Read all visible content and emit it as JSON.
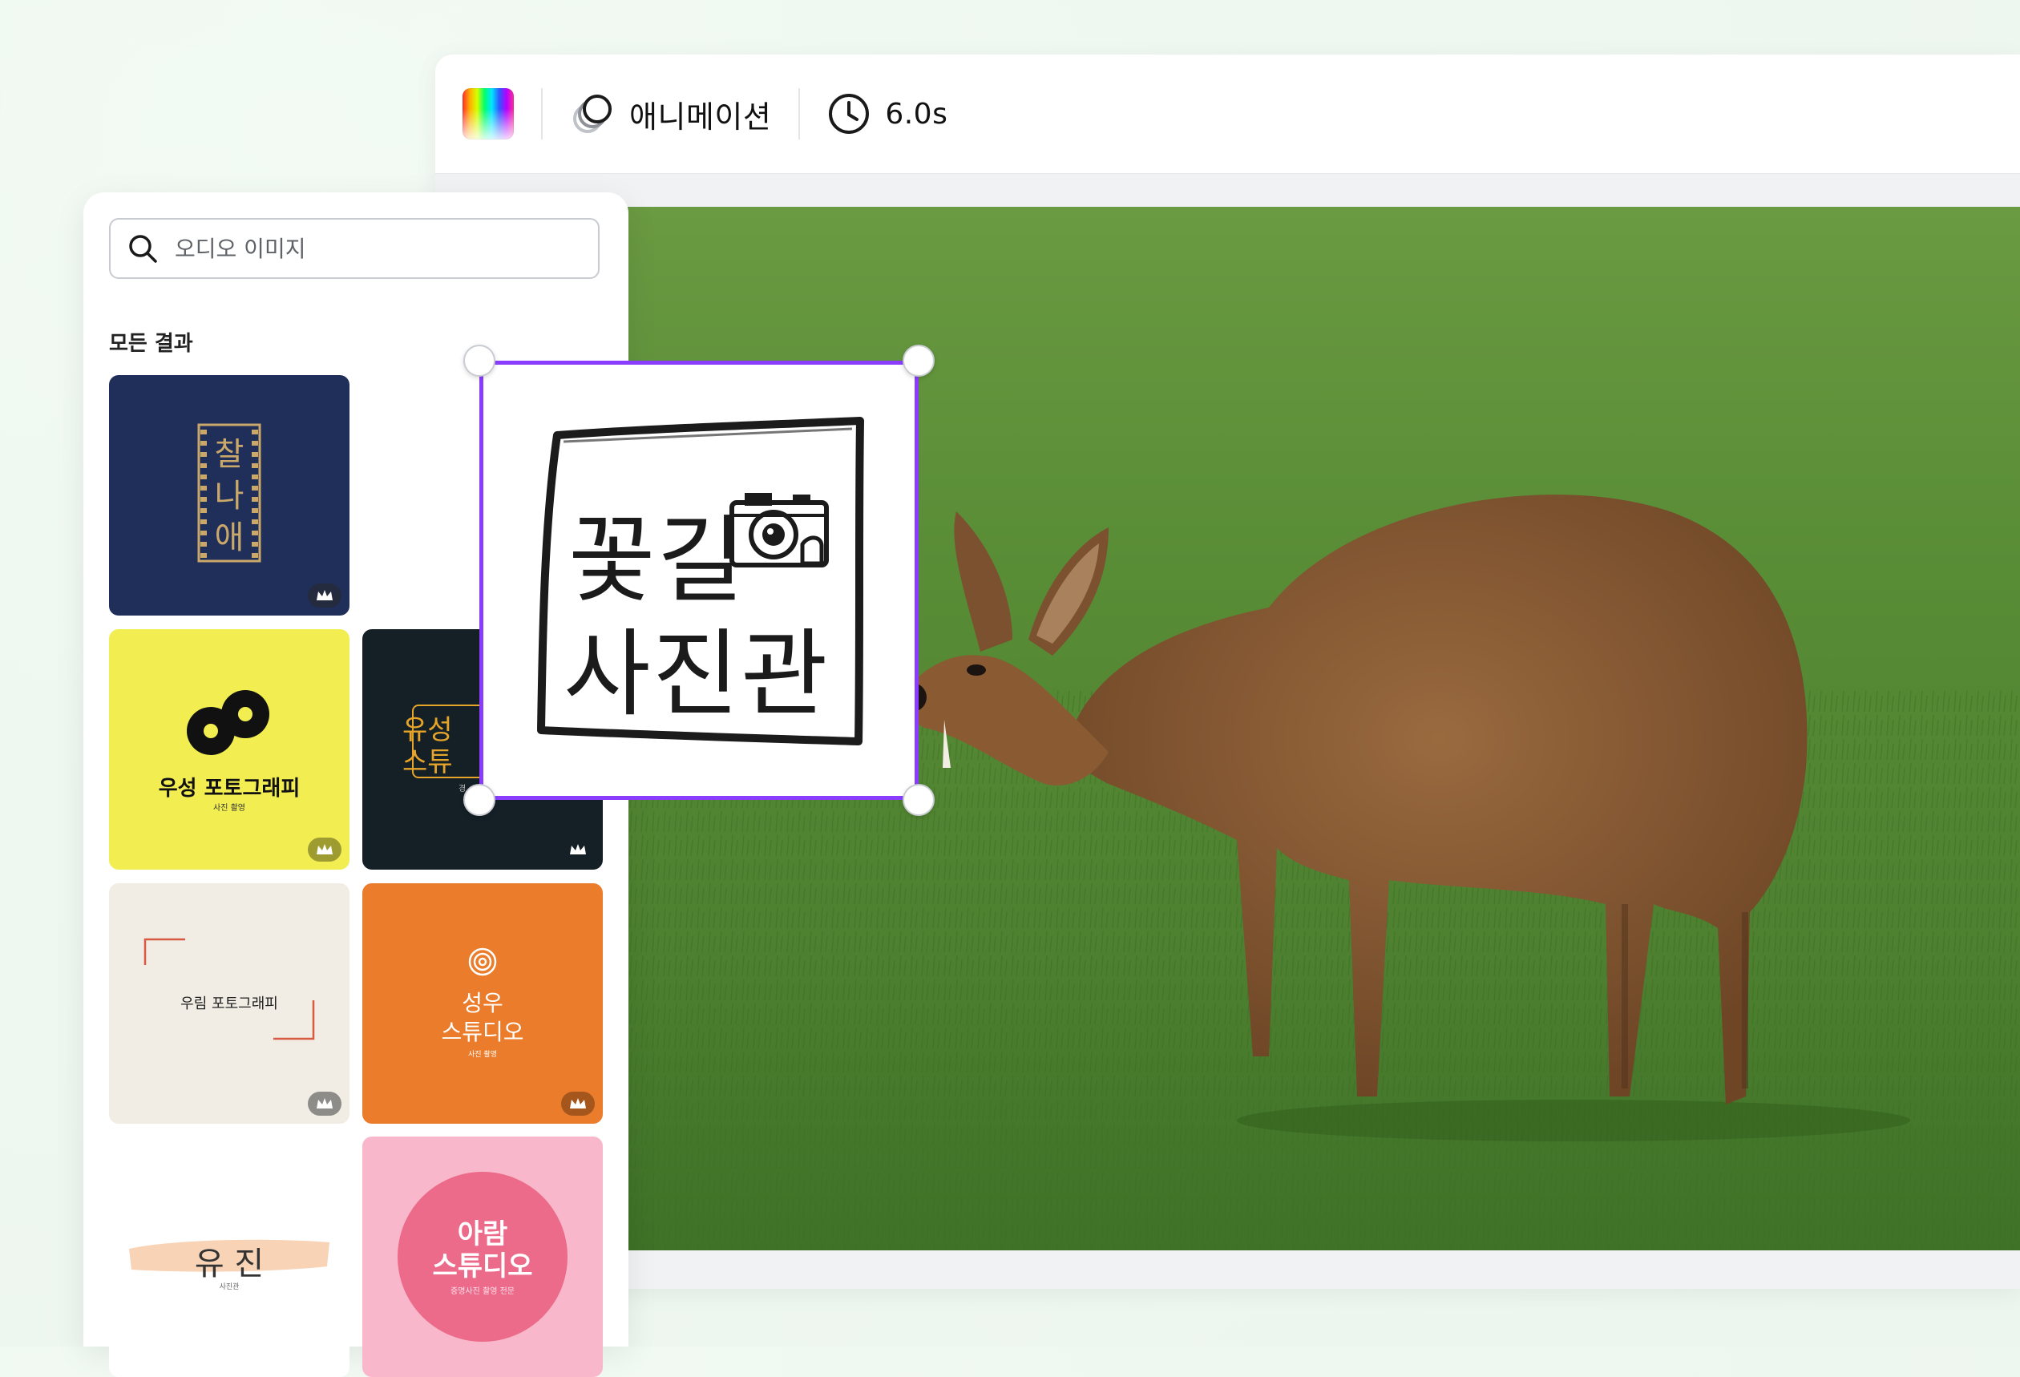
{
  "toolbar": {
    "color_icon": "color-palette",
    "animation_icon": "animation-icon",
    "animation_label": "애니메이션",
    "timer_icon": "clock-icon",
    "duration_label": "6.0s"
  },
  "panel": {
    "search": {
      "placeholder": "오디오 이미지",
      "value": ""
    },
    "section_title": "모든 결과",
    "templates": [
      {
        "name": "찰나애",
        "text": [
          "찰",
          "나",
          "애"
        ],
        "bg": "#1f2f5a",
        "premium": true
      },
      {
        "name": "우성 포토그래피",
        "title": "우성 포토그래피",
        "sub": "사진 촬영",
        "bg": "#f2ee52",
        "premium": true
      },
      {
        "name": "유성 스튜디오",
        "title": [
          "유성",
          "스튜"
        ],
        "sub": "경",
        "bg": "#141f26",
        "premium": true
      },
      {
        "name": "우림 포토그래피",
        "title": "우림 포토그래피",
        "bg": "#f1ede4",
        "premium": true
      },
      {
        "name": "성우 스튜디오",
        "title": [
          "성우",
          "스튜디오"
        ],
        "sub": "사진 촬영",
        "bg": "#ea7c2b",
        "premium": true
      },
      {
        "name": "유진",
        "title": "유 진",
        "sub": "사진관",
        "bg": "#ffffff",
        "premium": false
      },
      {
        "name": "아람 스튜디오",
        "title": [
          "아람",
          "스튜디오"
        ],
        "sub": "증명사진 촬영 전문",
        "bg": "#f9b7cb",
        "premium": false
      }
    ]
  },
  "selected_element": {
    "line1": "꽃길",
    "line2": "사진관",
    "icon": "camera-icon",
    "border_color": "#8b3dff"
  },
  "canvas": {
    "subject": "deer-on-grass"
  }
}
